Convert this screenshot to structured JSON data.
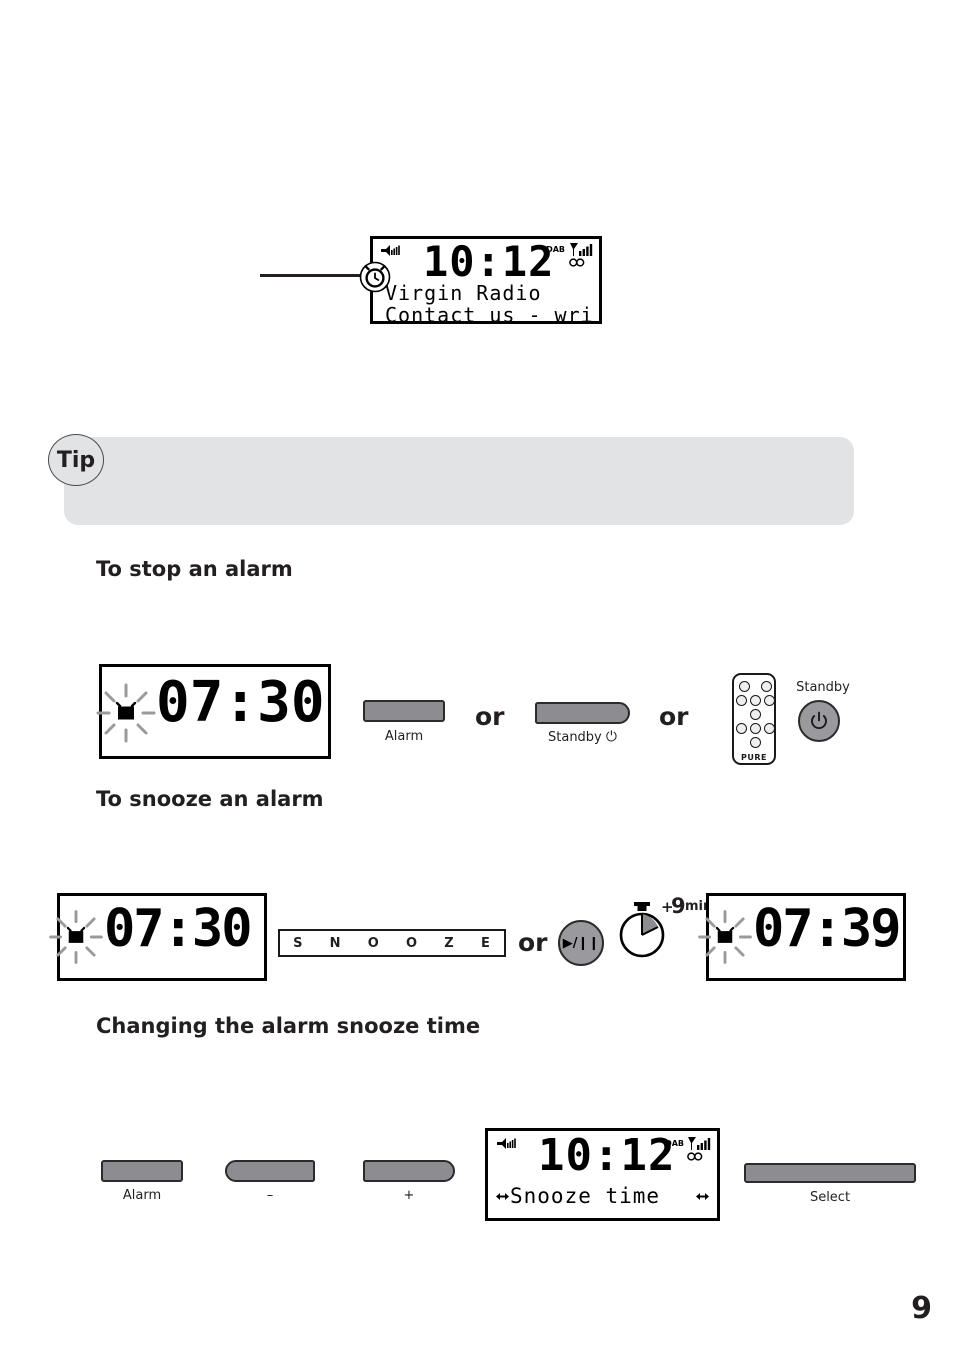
{
  "page": {
    "number": "9"
  },
  "tip": {
    "label": "Tip",
    "body": ""
  },
  "top_display": {
    "icons": {
      "speaker": "speaker-icon",
      "alarm": "alarm-clock-icon",
      "dab": "DAB",
      "signal": "signal-strength-icon",
      "stereo": "stereo-icon"
    },
    "time": "10:12",
    "line1": "Virgin Radio",
    "line2": "Contact us - wri"
  },
  "sections": [
    {
      "id": "stop",
      "heading": "To stop an alarm"
    },
    {
      "id": "snooze",
      "heading": "To snooze an alarm"
    },
    {
      "id": "change",
      "heading": "Changing the alarm snooze time"
    }
  ],
  "stop_alarm": {
    "display": {
      "time": "07:30",
      "alarm_icon": "alarm-clock-flashing-icon"
    },
    "alarm_button_label": "Alarm",
    "or_1": "or",
    "standby_button_label": "Standby",
    "standby_power_glyph": "⏻",
    "or_2": "or",
    "remote": {
      "brand": "PURE"
    },
    "standby_knob_label": "Standby"
  },
  "snooze_alarm": {
    "display_before": {
      "time": "07:30",
      "alarm_icon": "alarm-clock-flashing-icon"
    },
    "snooze_bar_letters": [
      "S",
      "N",
      "O",
      "O",
      "Z",
      "E"
    ],
    "or": "or",
    "play_pause_glyph": "▶/❙❙",
    "timer": {
      "plus": "+",
      "value": "9",
      "unit": "mins"
    },
    "display_after": {
      "time": "07:39",
      "alarm_icon": "alarm-clock-flashing-icon"
    }
  },
  "change_snooze": {
    "alarm_button_label": "Alarm",
    "minus_button_label": "–",
    "plus_button_label": "+",
    "display": {
      "time": "10:12",
      "menu_line": "Snooze time",
      "left_arrow_icon": "left-right-arrow-icon",
      "right_arrow_icon": "left-right-arrow-icon",
      "dab": "DAB",
      "speaker": "speaker-icon",
      "signal": "signal-strength-icon",
      "stereo": "stereo-icon"
    },
    "select_button_label": "Select"
  },
  "colors": {
    "button_grey": "#8d8d91",
    "tip_grey": "#e2e3e5",
    "ink": "#231f20"
  }
}
